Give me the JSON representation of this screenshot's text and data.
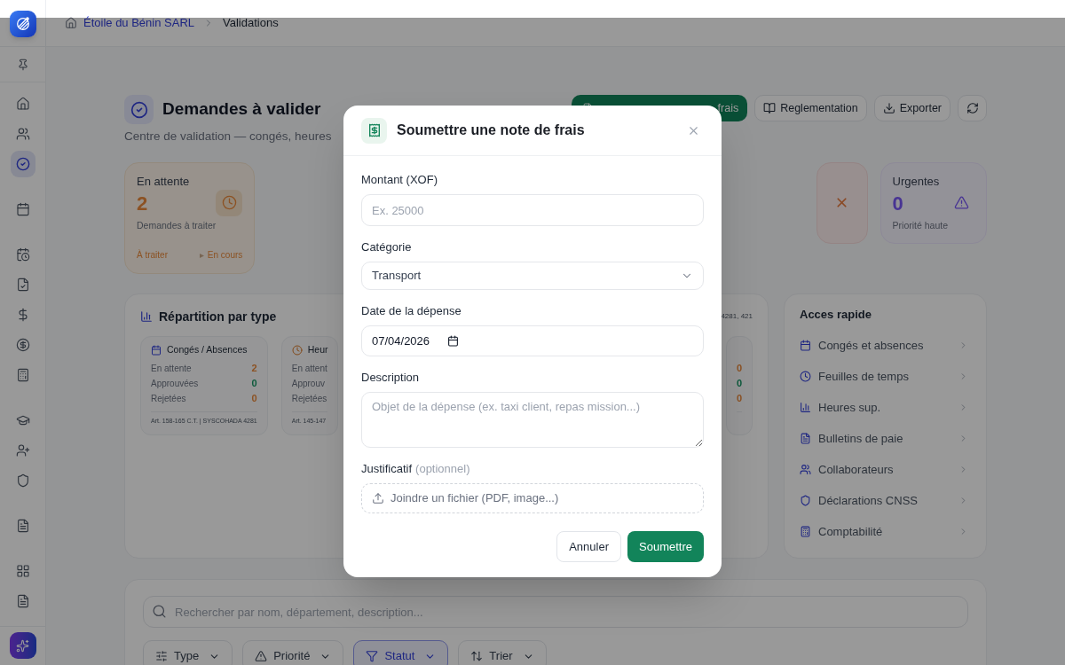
{
  "breadcrumb": [
    {
      "kind": "link",
      "label": "Étoile du Bénin SARL"
    },
    {
      "kind": "current",
      "label": "Validations"
    }
  ],
  "sidebar": {
    "groups": [
      {
        "items": [
          {
            "selected": false
          },
          {
            "selected": false
          },
          {
            "selected": true
          }
        ]
      },
      {
        "items": [
          {
            "selected": false
          }
        ]
      },
      {
        "items": [
          {
            "selected": false
          },
          {
            "selected": false
          },
          {
            "selected": false
          },
          {
            "selected": false
          },
          {
            "selected": false
          }
        ]
      },
      {
        "items": [
          {
            "selected": false
          },
          {
            "selected": false
          },
          {
            "selected": false
          }
        ]
      },
      {
        "items": [
          {
            "selected": false
          }
        ]
      },
      {
        "items": [
          {
            "selected": false
          },
          {
            "selected": false
          }
        ]
      }
    ]
  },
  "page": {
    "title": "Demandes à valider",
    "subtitle": "Centre de validation — congés, heures"
  },
  "actions": [
    {
      "kind": "primary",
      "label": "frais"
    },
    {
      "kind": "outline",
      "label": "Reglementation"
    },
    {
      "kind": "outline",
      "label": "Exporter"
    },
    {
      "kind": "icon"
    }
  ],
  "stat_cards": [
    {
      "kind": "pending",
      "label": "En attente",
      "value": "2",
      "caption": "Demandes à traiter",
      "footer": {
        "left": "À traiter",
        "right": "En cours"
      }
    },
    {
      "kind": "rejected"
    },
    {
      "kind": "urgent",
      "label": "Urgentes",
      "value": "0",
      "caption": "Priorité haute"
    }
  ],
  "breakdown": {
    "title": "Répartition par type",
    "note": "4281, 421",
    "cards": [
      {
        "title": "Congés / Absences",
        "rows": [
          {
            "kind": "pending",
            "label": "En attente",
            "value": "2"
          },
          {
            "kind": "approved",
            "label": "Approuvées",
            "value": "0"
          },
          {
            "kind": "rejected",
            "label": "Rejetées",
            "value": "0"
          }
        ],
        "footer": "Art. 158-165 C.T. | SYSCOHADA 4281"
      },
      {
        "title": "Heur",
        "rows": [
          {
            "label": "En attent"
          },
          {
            "label": "Approuv"
          },
          {
            "label": "Rejetées"
          }
        ],
        "footer": "Art. 145-147"
      },
      {
        "rows": [
          {
            "kind": "pending",
            "value": "0"
          },
          {
            "kind": "approved",
            "value": "0"
          },
          {
            "kind": "rejected",
            "value": "0"
          }
        ]
      }
    ]
  },
  "quick_access": {
    "title": "Acces rapide",
    "items": [
      {
        "label": "Congés et absences"
      },
      {
        "label": "Feuilles de temps"
      },
      {
        "label": "Heures sup."
      },
      {
        "label": "Bulletins de paie"
      },
      {
        "label": "Collaborateurs"
      },
      {
        "label": "Déclarations CNSS"
      },
      {
        "label": "Comptabilité"
      }
    ]
  },
  "search": {
    "placeholder": "Rechercher par nom, département, description..."
  },
  "filters": [
    {
      "label": "Type",
      "selected": false
    },
    {
      "label": "Priorité",
      "selected": false
    },
    {
      "label": "Statut",
      "selected": true
    },
    {
      "label": "Trier",
      "selected": false
    }
  ],
  "dialog": {
    "title": "Soumettre une note de frais",
    "fields": [
      {
        "kind": "text",
        "label": "Montant (XOF)",
        "placeholder": "Ex. 25000"
      },
      {
        "kind": "select",
        "label": "Catégorie",
        "value": "Transport"
      },
      {
        "kind": "date",
        "label": "Date de la dépense",
        "value": "07/04/2026"
      },
      {
        "kind": "textarea",
        "label": "Description",
        "placeholder": "Objet de la dépense (ex. taxi client, repas mission...)"
      },
      {
        "kind": "file",
        "label": "Justificatif",
        "note": "(optionnel)",
        "prompt": "Joindre un fichier (PDF, image...)"
      }
    ],
    "buttons": [
      {
        "kind": "secondary",
        "label": "Annuler"
      },
      {
        "kind": "primary",
        "label": "Soumettre"
      }
    ]
  }
}
